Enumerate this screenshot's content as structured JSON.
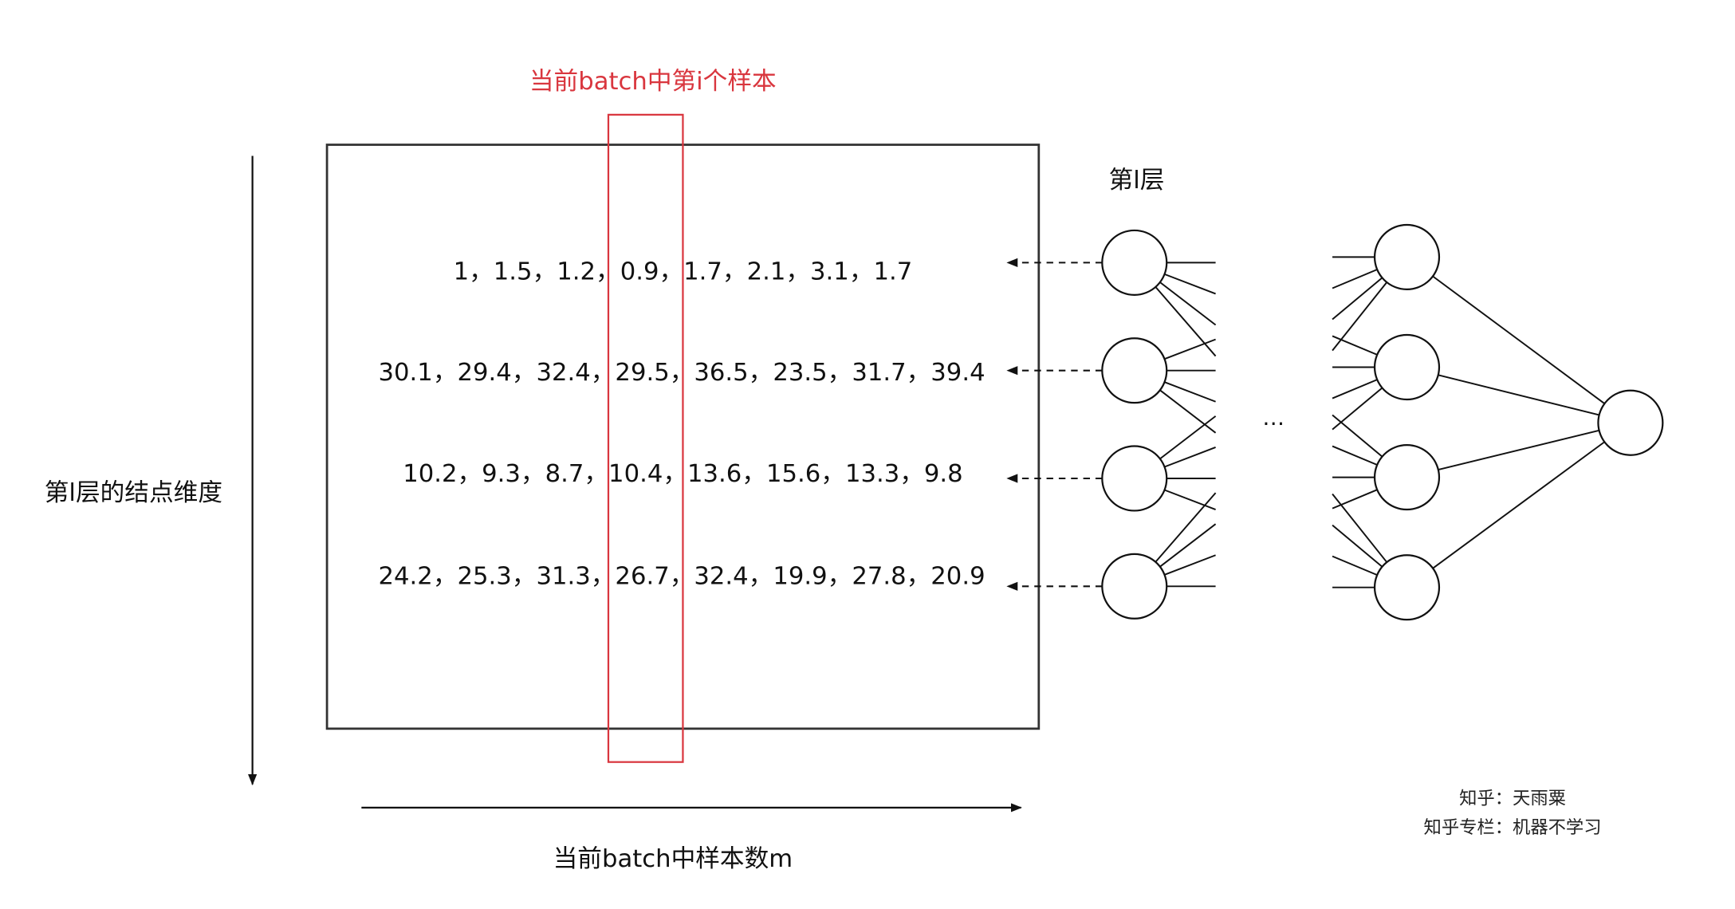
{
  "highlight_label": "当前batch中第i个样本",
  "matrix_rows": [
    "1，1.5，1.2，0.9，1.7，2.1，3.1，1.7",
    "30.1，29.4，32.4，29.5，36.5，23.5，31.7，39.4",
    "10.2，9.3，8.7，10.4，13.6，15.6，13.3，9.8",
    "24.2，25.3，31.3，26.7，32.4，19.9，27.8，20.9"
  ],
  "vertical_axis_label": "第l层的结点维度",
  "horizontal_axis_label": "当前batch中样本数m",
  "layer_label": "第l层",
  "ellipsis": "…",
  "credits": {
    "line1": "知乎：天雨粟",
    "line2": "知乎专栏：机器不学习"
  },
  "colors": {
    "highlight": "#d9363e",
    "stroke": "#1a1a1a"
  }
}
